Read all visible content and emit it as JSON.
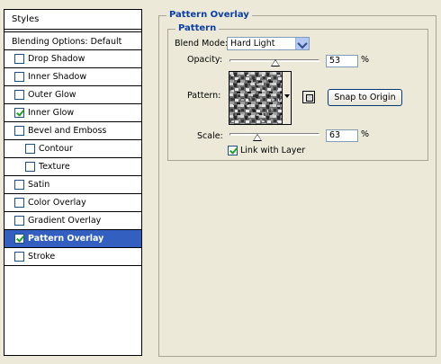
{
  "sidebar": {
    "header": "Styles",
    "blending_options": "Blending Options: Default",
    "items": [
      {
        "label": "Drop Shadow",
        "checked": false
      },
      {
        "label": "Inner Shadow",
        "checked": false
      },
      {
        "label": "Outer Glow",
        "checked": false
      },
      {
        "label": "Inner Glow",
        "checked": true
      },
      {
        "label": "Bevel and Emboss",
        "checked": false
      },
      {
        "label": "Contour",
        "checked": false
      },
      {
        "label": "Texture",
        "checked": false
      },
      {
        "label": "Satin",
        "checked": false
      },
      {
        "label": "Color Overlay",
        "checked": false
      },
      {
        "label": "Gradient Overlay",
        "checked": false
      },
      {
        "label": "Pattern Overlay",
        "checked": true,
        "selected": true
      },
      {
        "label": "Stroke",
        "checked": false
      }
    ]
  },
  "panel": {
    "title": "Pattern Overlay",
    "group_title": "Pattern",
    "blend_mode_label": "Blend Mode:",
    "blend_mode_value": "Hard Light",
    "opacity_label": "Opacity:",
    "opacity_value": "53",
    "opacity_unit": "%",
    "pattern_label": "Pattern:",
    "snap_button": "Snap to Origin",
    "scale_label": "Scale:",
    "scale_value": "63",
    "scale_unit": "%",
    "link_label": "Link with Layer",
    "link_checked": true
  },
  "colors": {
    "background": "#ece9d8",
    "selection": "#3360c0",
    "group_title": "#0a3fa8"
  }
}
